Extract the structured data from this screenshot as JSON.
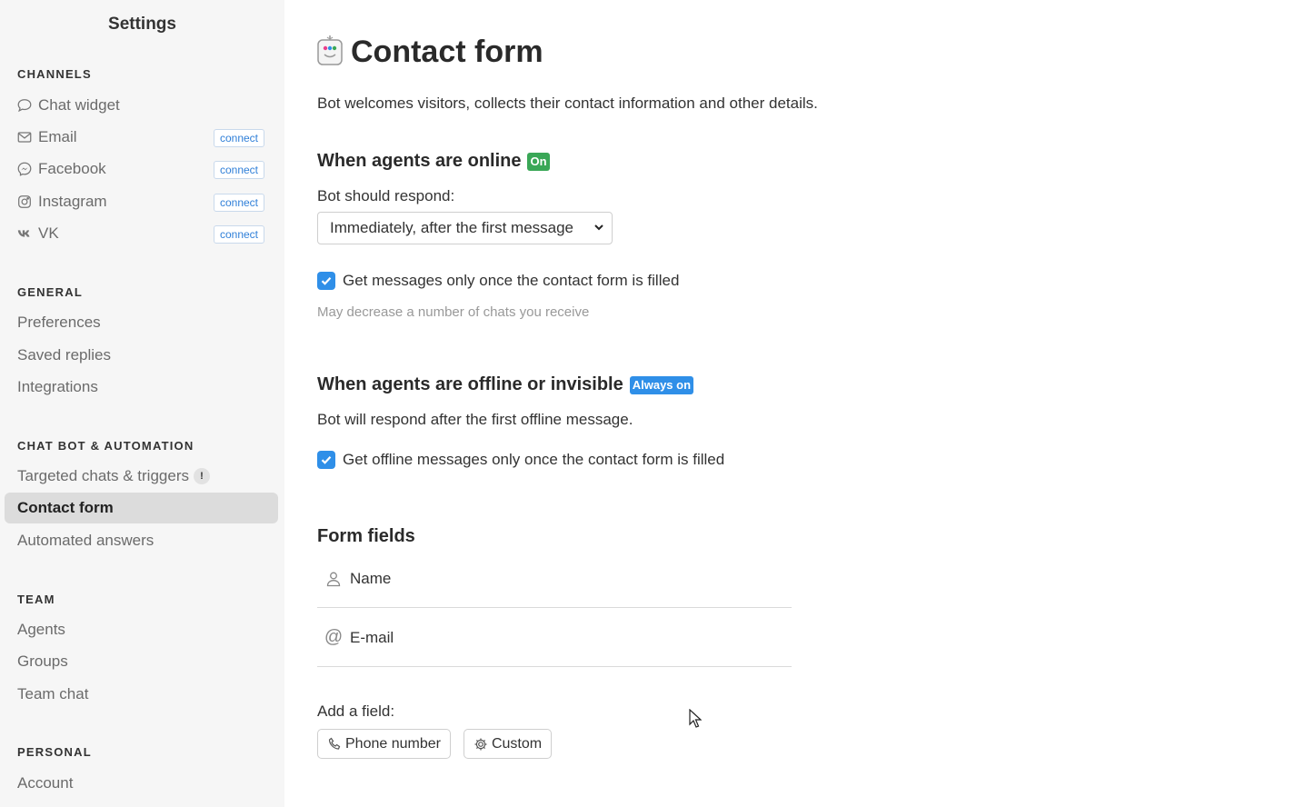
{
  "sidebar": {
    "title": "Settings",
    "sections": {
      "channels": "CHANNELS",
      "general": "GENERAL",
      "chatbot": "CHAT BOT & AUTOMATION",
      "team": "TEAM",
      "personal": "PERSONAL"
    },
    "channels": [
      {
        "label": "Chat widget",
        "icon": "chat-bubble-icon"
      },
      {
        "label": "Email",
        "icon": "envelope-icon",
        "action": "connect"
      },
      {
        "label": "Facebook",
        "icon": "messenger-icon",
        "action": "connect"
      },
      {
        "label": "Instagram",
        "icon": "instagram-icon",
        "action": "connect"
      },
      {
        "label": "VK",
        "icon": "vk-icon",
        "action": "connect"
      }
    ],
    "general": [
      "Preferences",
      "Saved replies",
      "Integrations"
    ],
    "chatbot": {
      "targeted": "Targeted chats & triggers",
      "targeted_badge": "!",
      "contact_form": "Contact form",
      "automated": "Automated answers"
    },
    "team": [
      "Agents",
      "Groups",
      "Team chat"
    ],
    "personal": [
      "Account"
    ]
  },
  "main": {
    "title": "Contact form",
    "description": "Bot welcomes visitors, collects their contact information and other details.",
    "online": {
      "heading": "When agents are online",
      "badge": "On",
      "respond_label": "Bot should respond:",
      "respond_value": "Immediately, after the first message",
      "checkbox_label": "Get messages only once the contact form is filled",
      "checkbox_checked": true,
      "hint": "May decrease a number of chats you receive"
    },
    "offline": {
      "heading": "When agents are offline or invisible",
      "badge": "Always on",
      "note": "Bot will respond after the first offline message.",
      "checkbox_label": "Get offline messages only once the contact form is filled",
      "checkbox_checked": true
    },
    "form_fields": {
      "heading": "Form fields",
      "fields": [
        {
          "label": "Name",
          "icon": "person-icon"
        },
        {
          "label": "E-mail",
          "icon": "at-sign-icon"
        }
      ],
      "add_label": "Add a field:",
      "add_buttons": [
        {
          "label": "Phone number",
          "icon": "phone-icon"
        },
        {
          "label": "Custom",
          "icon": "gear-icon"
        }
      ]
    }
  },
  "colors": {
    "accent": "#2f8fe8",
    "on_badge": "#3aa757",
    "sidebar_bg": "#f6f6f6",
    "active_item_bg": "#dcdcdc"
  }
}
